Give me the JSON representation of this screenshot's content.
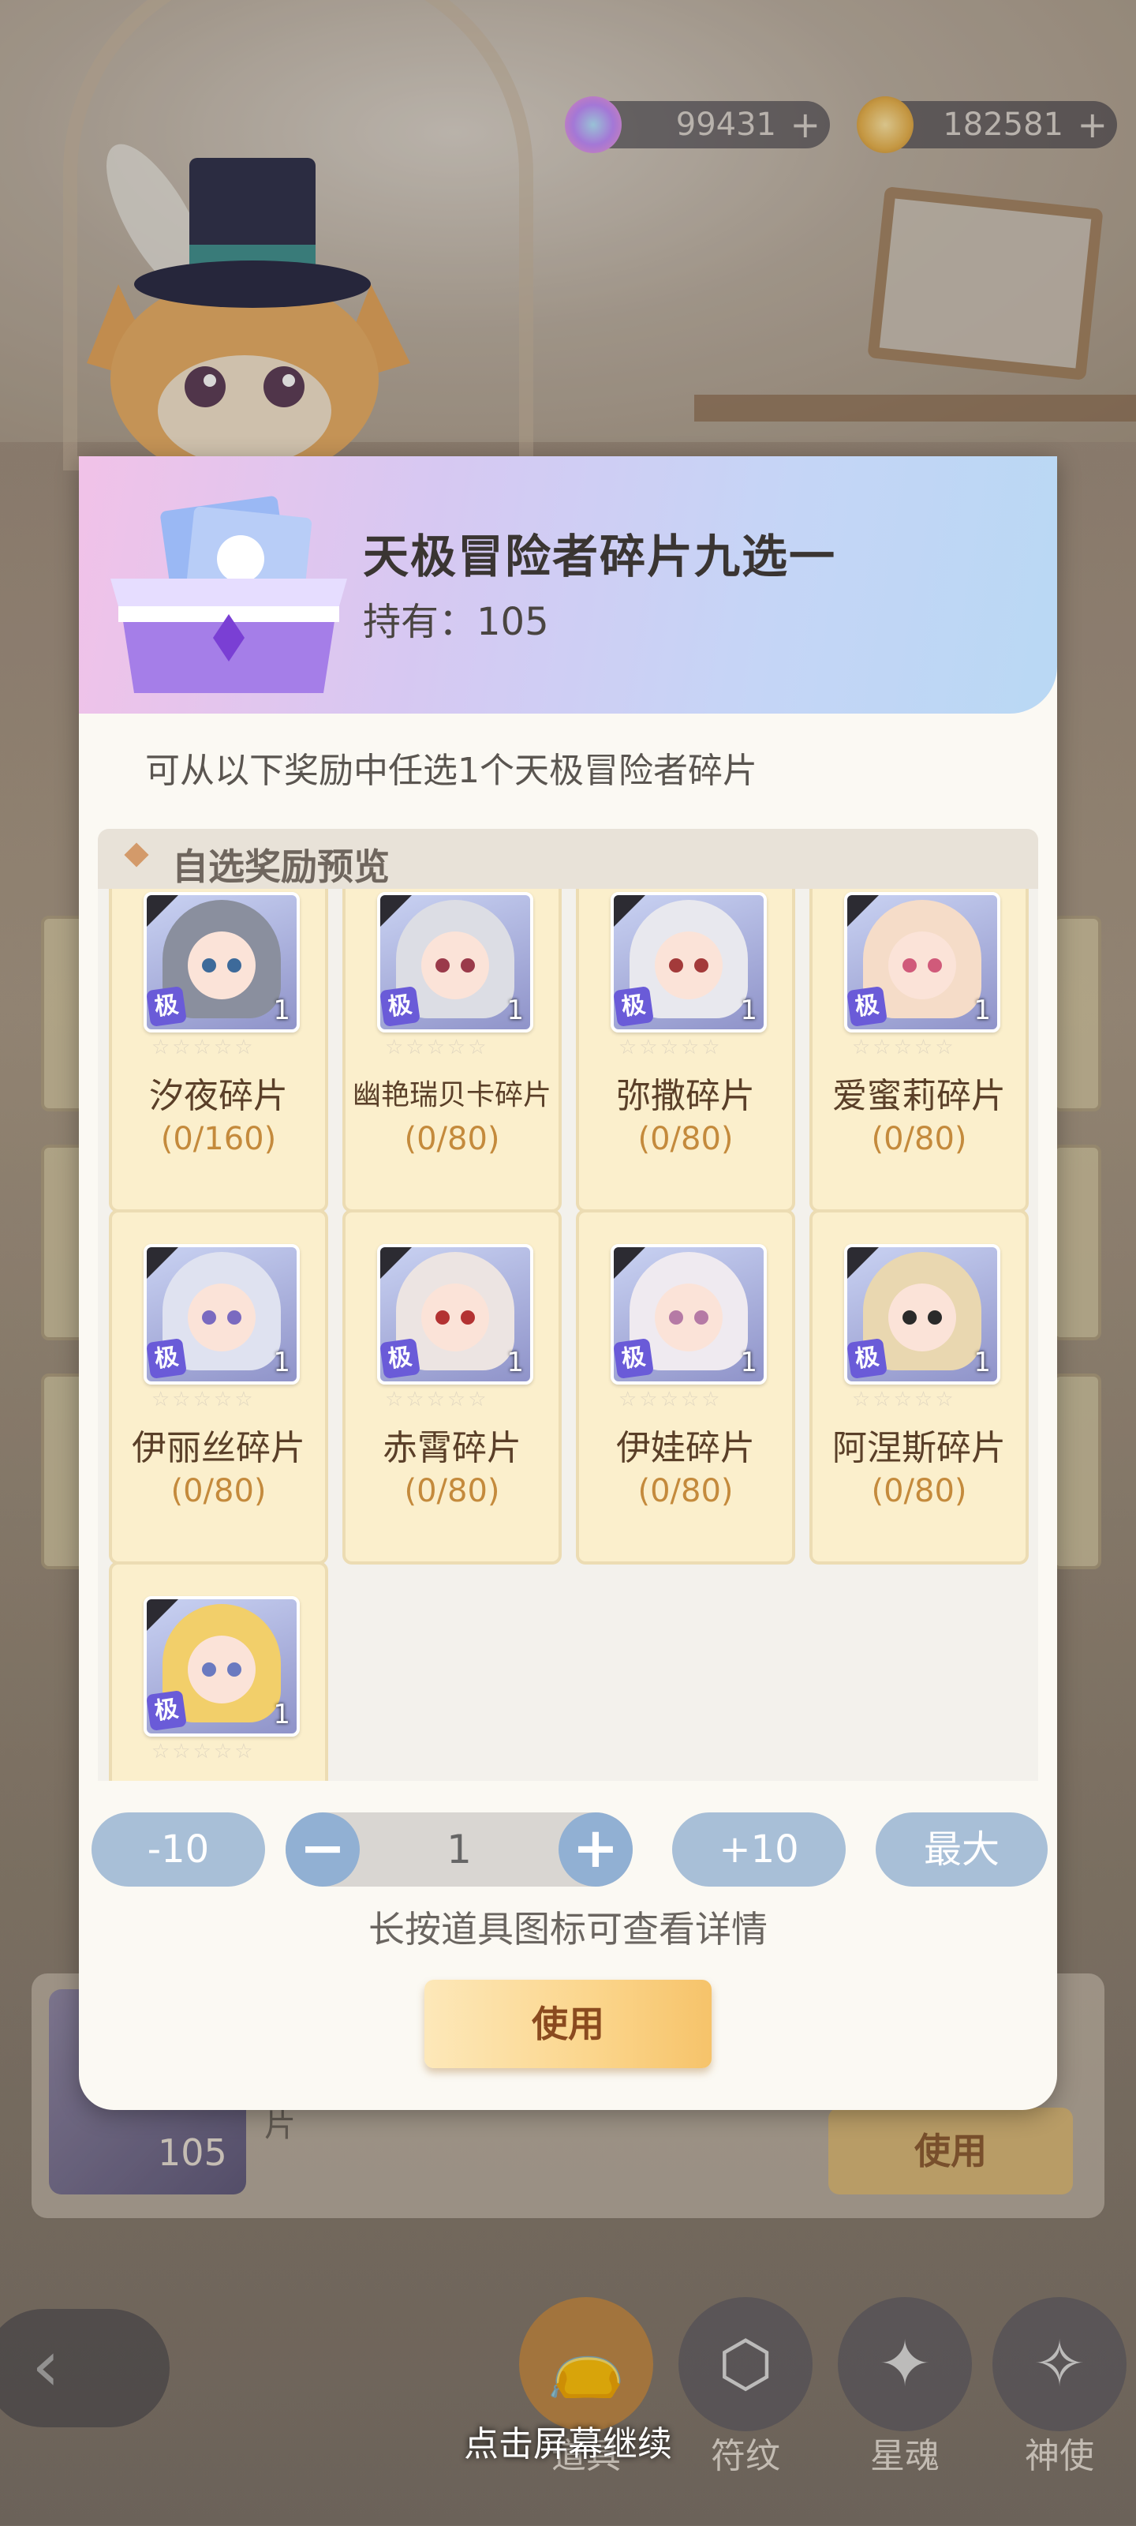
{
  "currency": {
    "gems": {
      "icon": "rainbow-gem-icon",
      "value": "99431",
      "add": "+"
    },
    "coins": {
      "icon": "paw-coin-icon",
      "value": "182581",
      "add": "+"
    }
  },
  "background": {
    "item_count": "105",
    "item_name_partial": "片",
    "use_label": "使用"
  },
  "dialog": {
    "title": "天极冒险者碎片九选一",
    "holding": "持有：105",
    "description": "可从以下奖励中任选1个天极冒险者碎片",
    "section_title": "自选奖励预览",
    "items": [
      {
        "name": "汐夜碎片",
        "count": "(0/160)",
        "badge": "极",
        "qty": "1",
        "stars": "☆☆☆☆☆",
        "hair": "#8a8f9e",
        "eye": "#3d6a9a"
      },
      {
        "name": "幽艳瑞贝卡碎片",
        "count": "(0/80)",
        "badge": "极",
        "qty": "1",
        "stars": "☆☆☆☆☆",
        "hair": "#dcdde4",
        "eye": "#9a3a4a"
      },
      {
        "name": "弥撒碎片",
        "count": "(0/80)",
        "badge": "极",
        "qty": "1",
        "stars": "☆☆☆☆☆",
        "hair": "#e8e8ee",
        "eye": "#a33a3a"
      },
      {
        "name": "爱蜜莉碎片",
        "count": "(0/80)",
        "badge": "极",
        "qty": "1",
        "stars": "☆☆☆☆☆",
        "hair": "#f5dcc8",
        "eye": "#d05a7a"
      },
      {
        "name": "伊丽丝碎片",
        "count": "(0/80)",
        "badge": "极",
        "qty": "1",
        "stars": "☆☆☆☆☆",
        "hair": "#dfe2f0",
        "eye": "#7a6ac0"
      },
      {
        "name": "赤霄碎片",
        "count": "(0/80)",
        "badge": "极",
        "qty": "1",
        "stars": "☆☆☆☆☆",
        "hair": "#ece4e2",
        "eye": "#b33232"
      },
      {
        "name": "伊娃碎片",
        "count": "(0/80)",
        "badge": "极",
        "qty": "1",
        "stars": "☆☆☆☆☆",
        "hair": "#efeaf0",
        "eye": "#b57aa5"
      },
      {
        "name": "阿涅斯碎片",
        "count": "(0/80)",
        "badge": "极",
        "qty": "1",
        "stars": "☆☆☆☆☆",
        "hair": "#e9d7b0",
        "eye": "#2a2a2a"
      },
      {
        "name": "",
        "count": "",
        "badge": "极",
        "qty": "1",
        "stars": "☆☆☆☆☆",
        "hair": "#f2cf6a",
        "eye": "#6a7ac0"
      }
    ],
    "controls": {
      "minus10": "-10",
      "minus": "−",
      "quantity": "1",
      "plus": "+",
      "plus10": "+10",
      "max": "最大"
    },
    "hint": "长按道具图标可查看详情",
    "use_label": "使用"
  },
  "nav": {
    "back_icon": "back-arrow-icon",
    "items": [
      {
        "label": "道具",
        "icon": "bag-icon",
        "active": true
      },
      {
        "label": "符纹",
        "icon": "dice-icon",
        "active": false
      },
      {
        "label": "星魂",
        "icon": "star-card-icon",
        "active": false
      },
      {
        "label": "神使",
        "icon": "winged-crest-icon",
        "active": false
      }
    ]
  },
  "continue_text": "点击屏幕继续",
  "colors": {
    "accent_blue": "#a8bfd7",
    "use_gold": "#fbd58b",
    "count_orange": "#c48a3c",
    "name_brown": "#5a3f28"
  }
}
